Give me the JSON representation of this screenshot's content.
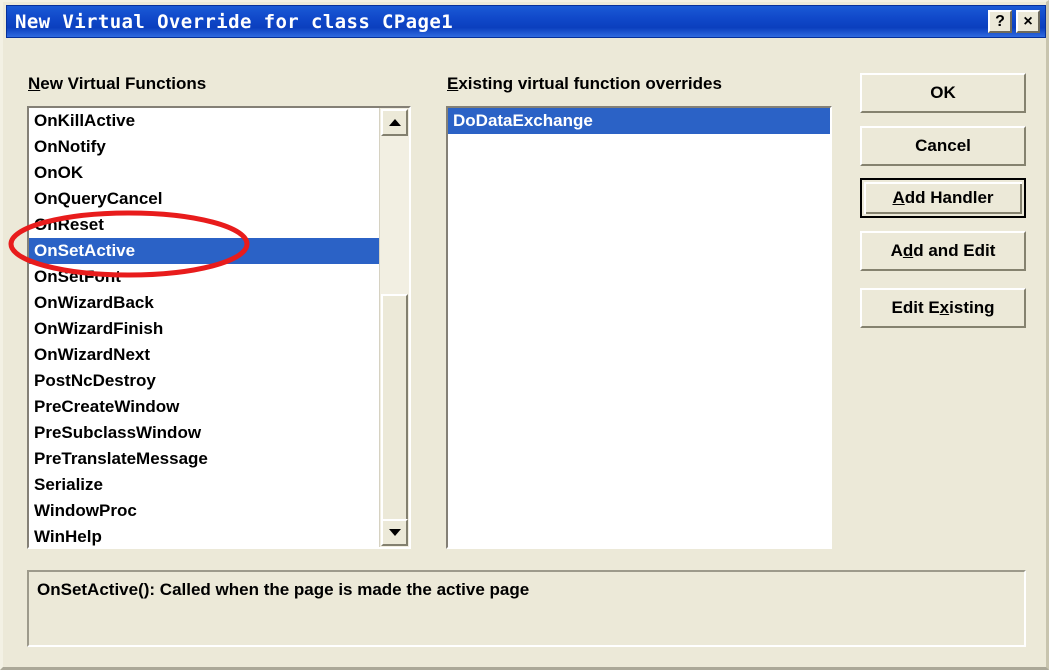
{
  "window": {
    "title": "New Virtual Override for class CPage1",
    "titlebar_color": "#0b3fbe",
    "background_color": "#ece9d8",
    "help_button": "?",
    "close_button": "×"
  },
  "new_functions": {
    "label_accel": "N",
    "label_rest": "ew Virtual Functions",
    "items": [
      "OnKillActive",
      "OnNotify",
      "OnOK",
      "OnQueryCancel",
      "OnReset",
      "OnSetActive",
      "OnSetFont",
      "OnWizardBack",
      "OnWizardFinish",
      "OnWizardNext",
      "PostNcDestroy",
      "PreCreateWindow",
      "PreSubclassWindow",
      "PreTranslateMessage",
      "Serialize",
      "WindowProc",
      "WinHelp"
    ],
    "selected": "OnSetActive",
    "selection_color": "#2b62c6",
    "scrollbar": {
      "up_arrow": "scroll-up",
      "down_arrow": "scroll-down",
      "thumb": "scroll-thumb"
    }
  },
  "existing_overrides": {
    "label_accel": "E",
    "label_rest": "xisting virtual function overrides",
    "items": [
      "DoDataExchange"
    ],
    "selected": "DoDataExchange",
    "selection_color": "#2b62c6"
  },
  "buttons": [
    {
      "name": "ok-button",
      "accel": "",
      "pre": "OK",
      "post": "",
      "default": false
    },
    {
      "name": "cancel-button",
      "accel": "",
      "pre": "Cancel",
      "post": "",
      "default": false
    },
    {
      "name": "add-handler-button",
      "accel": "A",
      "pre": "",
      "post": "dd Handler",
      "default": true
    },
    {
      "name": "add-and-edit-button",
      "accel": "d",
      "pre": "A",
      "post": "d and Edit",
      "default": false
    },
    {
      "name": "edit-existing-button",
      "accel": "x",
      "pre": "Edit E",
      "post": "isting",
      "default": false
    }
  ],
  "description": {
    "text": "OnSetActive(): Called when the page is made the active page"
  },
  "annotation": {
    "shape": "ellipse",
    "color": "#e81c1c",
    "targets": [
      "OnReset",
      "OnSetActive",
      "OnSetFont"
    ]
  }
}
